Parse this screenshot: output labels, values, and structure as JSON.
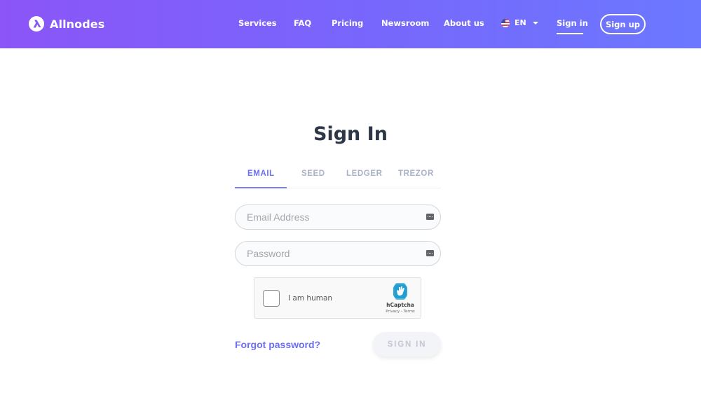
{
  "header": {
    "brand": "Allnodes",
    "nav": [
      {
        "label": "Services"
      },
      {
        "label": "FAQ"
      },
      {
        "label": "Pricing"
      },
      {
        "label": "Newsroom"
      },
      {
        "label": "About us"
      }
    ],
    "language": {
      "code": "EN",
      "flag": "us-flag-icon"
    },
    "sign_in_label": "Sign in",
    "sign_up_label": "Sign up"
  },
  "page": {
    "title": "Sign In",
    "tabs": [
      {
        "label": "EMAIL",
        "active": true
      },
      {
        "label": "SEED",
        "active": false
      },
      {
        "label": "LEDGER",
        "active": false
      },
      {
        "label": "TREZOR",
        "active": false
      }
    ],
    "email_field": {
      "value": "",
      "placeholder": "Email Address"
    },
    "password_field": {
      "value": "",
      "placeholder": "Password"
    },
    "captcha": {
      "label": "I am human",
      "checked": false,
      "brand": "hCaptcha",
      "links": "Privacy - Terms"
    },
    "forgot_password_label": "Forgot password?",
    "submit_label": "SIGN IN"
  },
  "colors": {
    "header_gradient_start": "#8b55f7",
    "header_gradient_end": "#6b78ff",
    "accent": "#6c6ef5",
    "title": "#2d3748",
    "inactive_tab": "#a9b1c7"
  }
}
